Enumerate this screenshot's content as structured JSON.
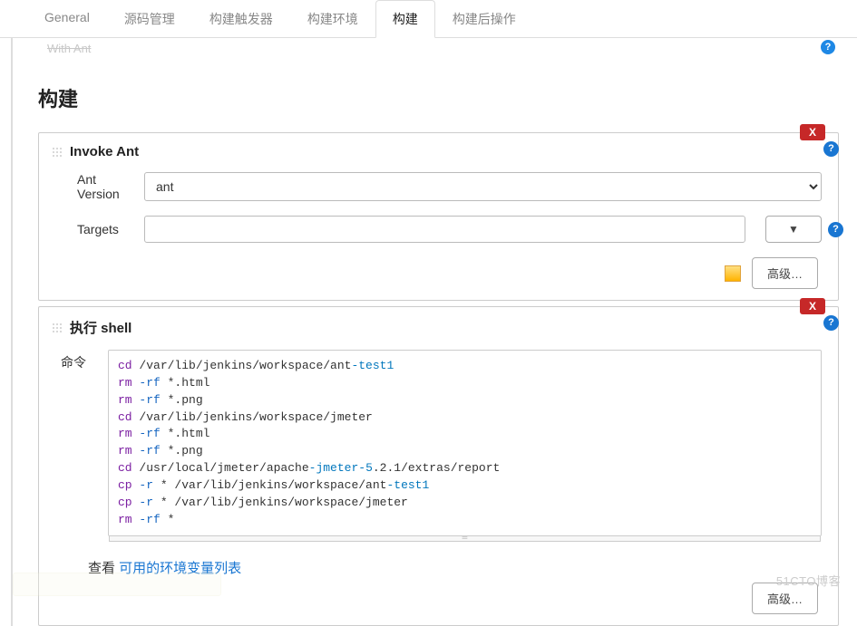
{
  "tabs": [
    {
      "label": "General"
    },
    {
      "label": "源码管理"
    },
    {
      "label": "构建触发器"
    },
    {
      "label": "构建环境"
    },
    {
      "label": "构建",
      "active": true
    },
    {
      "label": "构建后操作"
    }
  ],
  "cut_prev": "With Ant",
  "section_title": "构建",
  "invoke_ant": {
    "title": "Invoke Ant",
    "close": "X",
    "version_label": "Ant Version",
    "version_value": "ant",
    "targets_label": "Targets",
    "targets_value": "",
    "expand_glyph": "▼",
    "advanced_btn": "高级…"
  },
  "exec_shell": {
    "title": "执行 shell",
    "close": "X",
    "cmd_label": "命令",
    "code_lines": [
      {
        "t": "cd",
        "k": "kw",
        "rest": " /var/lib/jenkins/workspace/ant",
        "hl": "-test1"
      },
      {
        "t": "rm",
        "k": "kw",
        "fl": " -rf",
        "rest": " *.html"
      },
      {
        "t": "rm",
        "k": "kw",
        "fl": " -rf",
        "rest": " *.png"
      },
      {
        "t": "cd",
        "k": "kw",
        "rest": " /var/lib/jenkins/workspace/jmeter"
      },
      {
        "t": "rm",
        "k": "kw",
        "fl": " -rf",
        "rest": " *.html"
      },
      {
        "t": "rm",
        "k": "kw",
        "fl": " -rf",
        "rest": " *.png"
      },
      {
        "t": "cd",
        "k": "kw",
        "rest": " /usr/local/jmeter/apache",
        "hl": "-jmeter-5",
        "rest2": ".2.1/extras/report"
      },
      {
        "t": "cp",
        "k": "kw",
        "fl": " -r",
        "rest": " * /var/lib/jenkins/workspace/ant",
        "hl": "-test1"
      },
      {
        "t": "cp",
        "k": "kw",
        "fl": " -r",
        "rest": " * /var/lib/jenkins/workspace/jmeter"
      },
      {
        "t": "rm",
        "k": "kw",
        "fl": " -rf",
        "rest": " *"
      }
    ],
    "see_prefix": "查看 ",
    "see_link": "可用的环境变量列表",
    "advanced_btn": "高级…"
  },
  "help_glyph": "?",
  "watermark": "51CTO博客"
}
